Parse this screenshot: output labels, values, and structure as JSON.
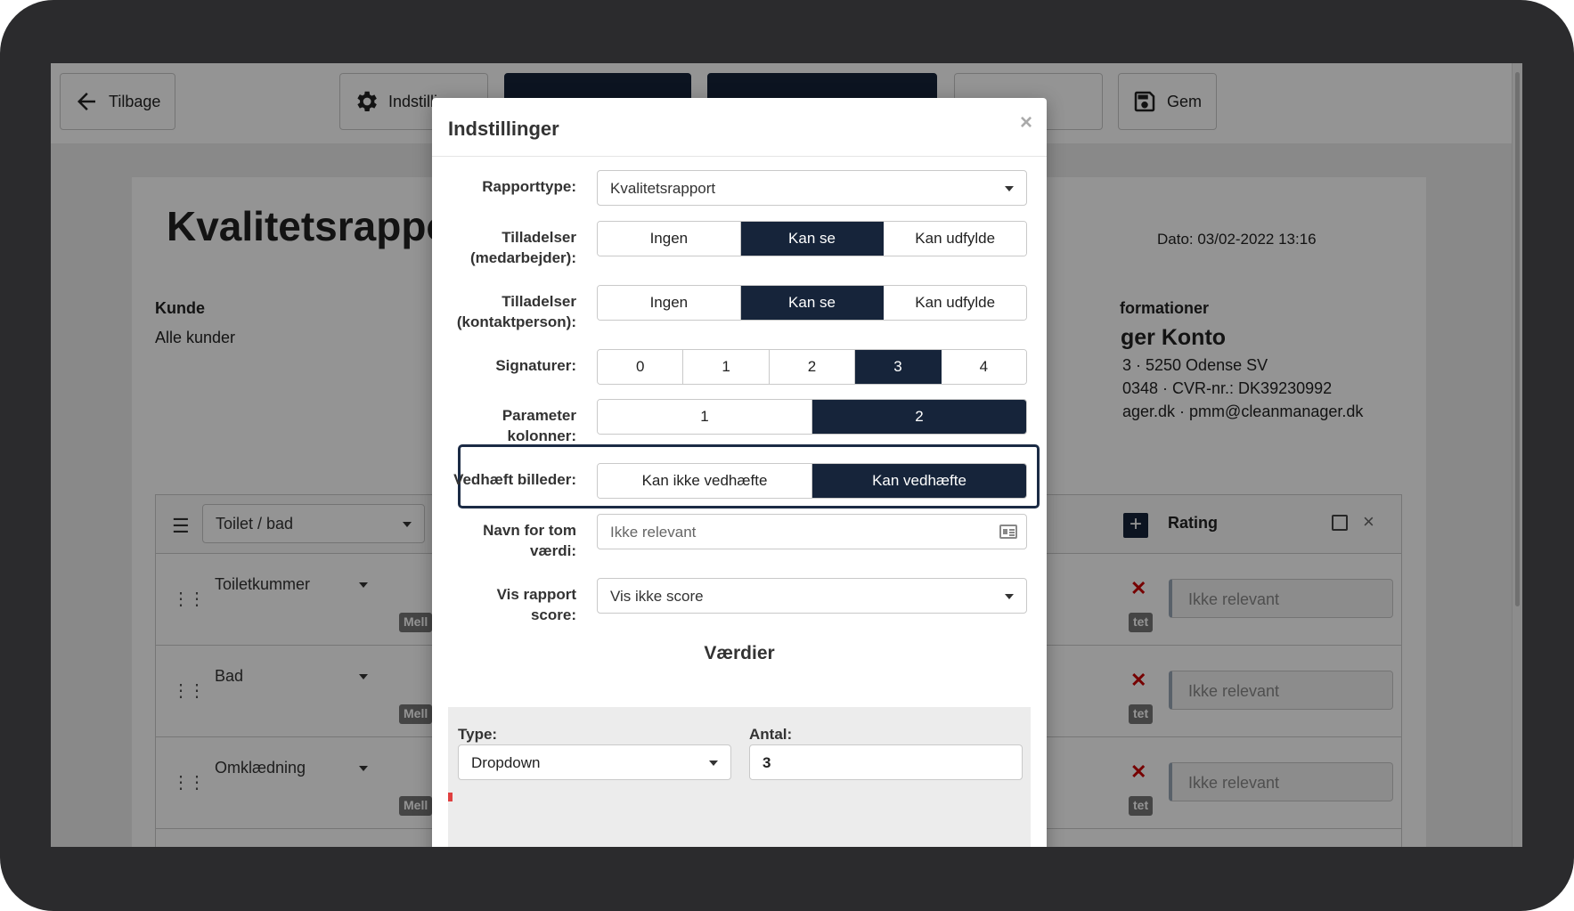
{
  "toolbar": {
    "back_label": "Tilbage",
    "settings_label": "Indstillinger",
    "save_label": "Gem"
  },
  "document": {
    "title": "Kvalitetsrapport",
    "date": "Dato: 03/02-2022 13:16",
    "customer_label": "Kunde",
    "customer_value": "Alle kunder",
    "info_label": "formationer",
    "info_name": "ger Konto",
    "info_lines": [
      "3 · 5250 Odense SV",
      "0348 · CVR-nr.: DK39230992",
      "ager.dk · pmm@cleanmanager.dk"
    ]
  },
  "table": {
    "header_select": "Toilet / bad",
    "rating_label": "Rating",
    "rows": [
      {
        "name": "Toiletkummer",
        "badge": "Mell",
        "badge_right": "tet",
        "rating": "Ikke relevant"
      },
      {
        "name": "Bad",
        "badge": "Mell",
        "badge_right": "tet",
        "rating": "Ikke relevant"
      },
      {
        "name": "Omklædning",
        "badge": "Mell",
        "badge_right": "tet",
        "rating": "Ikke relevant"
      }
    ]
  },
  "modal": {
    "title": "Indstillinger",
    "close": "×",
    "report_type": {
      "label": "Rapporttype:",
      "value": "Kvalitetsrapport"
    },
    "perm_employee": {
      "label1": "Tilladelser",
      "label2": "(medarbejder):",
      "options": [
        "Ingen",
        "Kan se",
        "Kan udfylde"
      ],
      "selected": "Kan se"
    },
    "perm_contact": {
      "label1": "Tilladelser",
      "label2": "(kontaktperson):",
      "options": [
        "Ingen",
        "Kan se",
        "Kan udfylde"
      ],
      "selected": "Kan se"
    },
    "signatures": {
      "label": "Signaturer:",
      "options": [
        "0",
        "1",
        "2",
        "3",
        "4"
      ],
      "selected": "3"
    },
    "param_columns": {
      "label1": "Parameter",
      "label2": "kolonner:",
      "options": [
        "1",
        "2"
      ],
      "selected": "2"
    },
    "attach_images": {
      "label": "Vedhæft billeder:",
      "options": [
        "Kan ikke vedhæfte",
        "Kan vedhæfte"
      ],
      "selected": "Kan vedhæfte"
    },
    "empty_name": {
      "label1": "Navn for tom",
      "label2": "værdi:",
      "value": "Ikke relevant"
    },
    "show_score": {
      "label1": "Vis rapport",
      "label2": "score:",
      "value": "Vis ikke score"
    },
    "values_title": "Værdier",
    "values": {
      "type_label": "Type:",
      "type_value": "Dropdown",
      "count_label": "Antal:",
      "count_value": "3"
    }
  },
  "colors": {
    "accent": "#16243a",
    "bezel": "#2b2b2d",
    "overlay": "rgba(0,0,0,0.42)"
  }
}
